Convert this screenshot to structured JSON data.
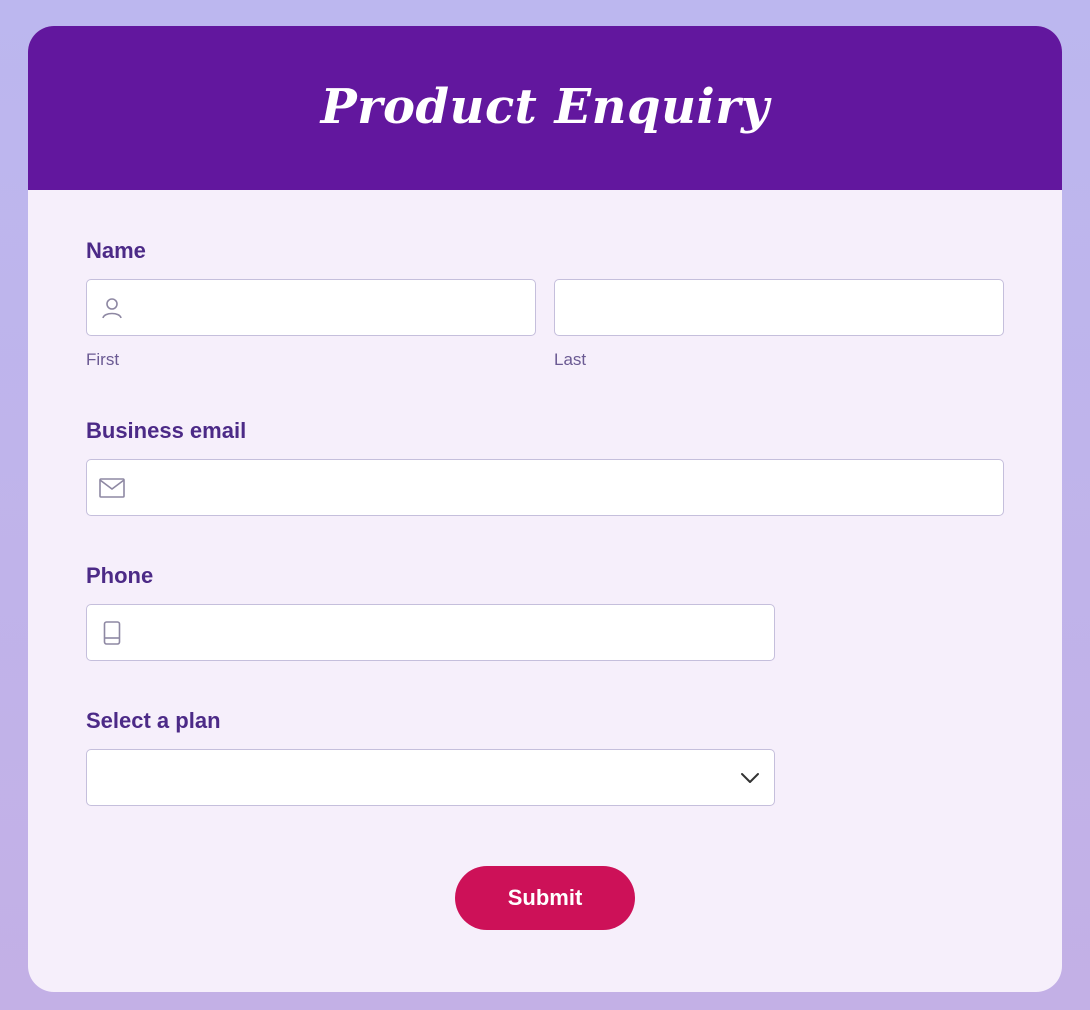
{
  "form": {
    "title": "Product Enquiry",
    "name": {
      "label": "Name",
      "first": {
        "value": "",
        "sub_label": "First",
        "icon": "user-icon"
      },
      "last": {
        "value": "",
        "sub_label": "Last"
      }
    },
    "email": {
      "label": "Business email",
      "value": "",
      "icon": "mail-icon"
    },
    "phone": {
      "label": "Phone",
      "value": "",
      "icon": "phone-icon"
    },
    "plan": {
      "label": "Select a plan",
      "selected": "",
      "icon": "chevron-down-icon"
    },
    "submit_label": "Submit"
  },
  "colors": {
    "header": "#62179e",
    "card": "#f6effb",
    "label": "#4c2a87",
    "submit": "#cd1158",
    "background": "#bcb7ef"
  }
}
